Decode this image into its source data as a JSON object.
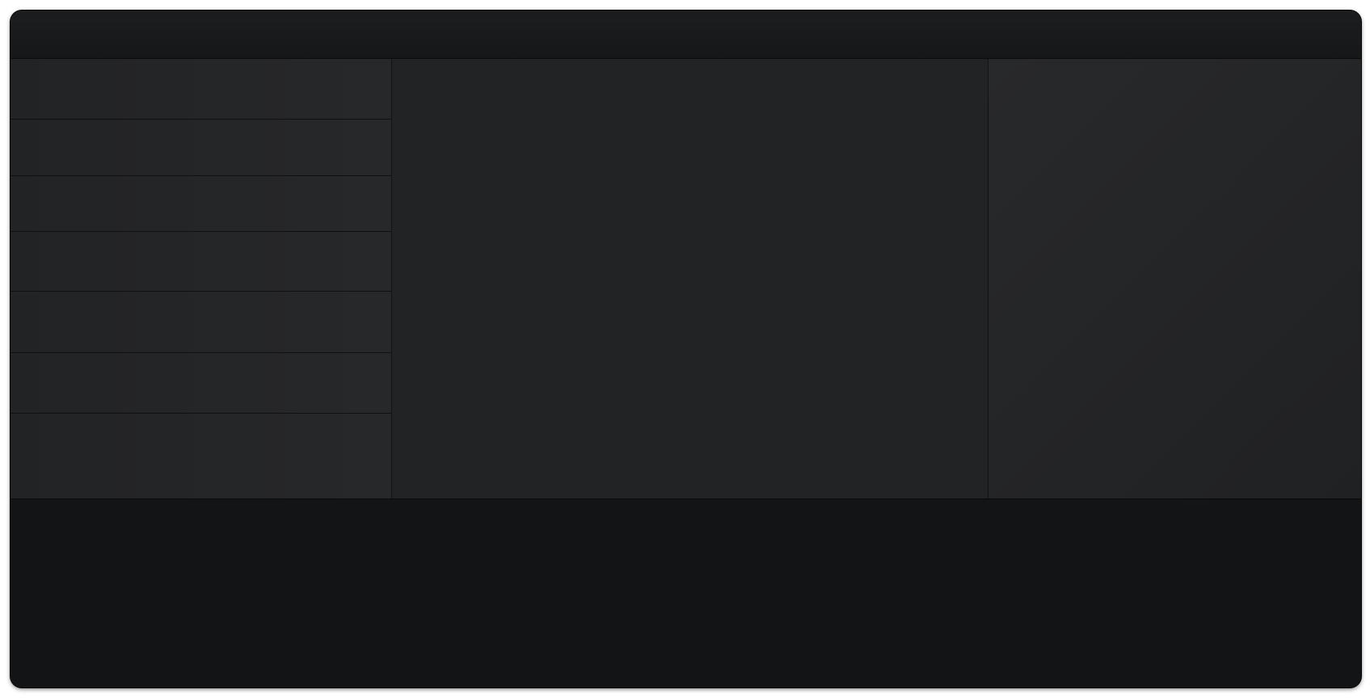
{
  "window": {
    "title": ""
  },
  "sidebar": {
    "items": [
      {
        "label": ""
      },
      {
        "label": ""
      },
      {
        "label": ""
      },
      {
        "label": ""
      },
      {
        "label": ""
      },
      {
        "label": ""
      },
      {
        "label": ""
      }
    ]
  },
  "main": {
    "content": ""
  },
  "detail": {
    "content": ""
  },
  "footer": {
    "content": ""
  },
  "colors": {
    "window_bg": "#1d1e20",
    "titlebar_bg": "#161718",
    "sidebar_item_bg": "#242527",
    "main_bg": "#222325",
    "right_bg": "#252628",
    "bottom_bg": "#131415",
    "divider": "#0f1011"
  }
}
